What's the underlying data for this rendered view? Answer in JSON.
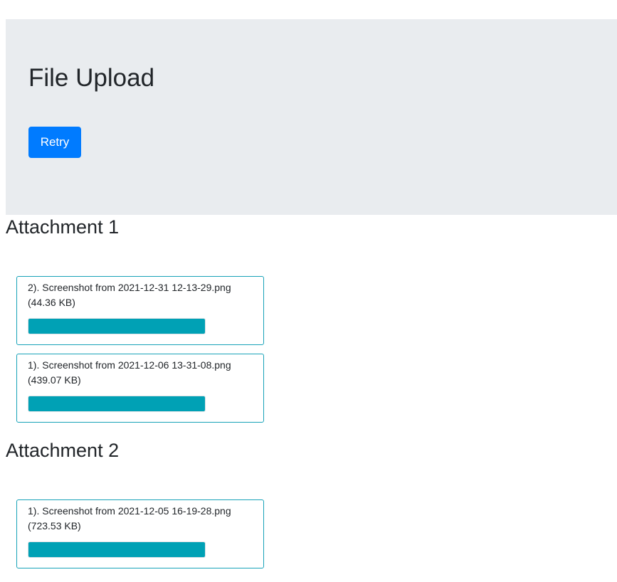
{
  "header": {
    "title": "File Upload",
    "retry_label": "Retry"
  },
  "colors": {
    "jumbotron_bg": "#e9ecef",
    "primary_button": "#007bff",
    "card_border": "#17a2b8",
    "progress_fill": "#00a1b5"
  },
  "attachments": [
    {
      "title": "Attachment 1",
      "files": [
        {
          "name": "2). Screenshot from 2021-12-31 12-13-29.png",
          "size": "(44.36 KB)",
          "progress": 1.0
        },
        {
          "name": "1). Screenshot from 2021-12-06 13-31-08.png",
          "size": "(439.07 KB)",
          "progress": 1.0
        }
      ]
    },
    {
      "title": "Attachment 2",
      "files": [
        {
          "name": "1). Screenshot from 2021-12-05 16-19-28.png",
          "size": "(723.53 KB)",
          "progress": 1.0
        }
      ]
    }
  ]
}
